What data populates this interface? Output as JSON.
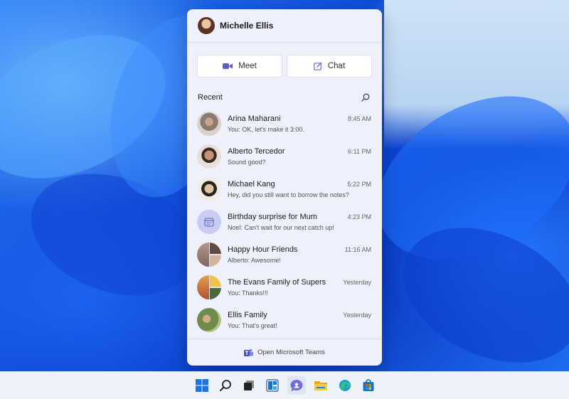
{
  "flyout": {
    "profile_name": "Michelle Ellis",
    "meet_label": "Meet",
    "chat_label": "Chat",
    "recent_title": "Recent",
    "conversations": [
      {
        "name": "Arina Maharani",
        "time": "8:45 AM",
        "preview": "You: OK, let's make it 3:00."
      },
      {
        "name": "Alberto Tercedor",
        "time": "6:11 PM",
        "preview": "Sound good?"
      },
      {
        "name": "Michael Kang",
        "time": "5:22 PM",
        "preview": "Hey, did you still want to borrow the notes?"
      },
      {
        "name": "Birthday surprise for Mum",
        "time": "4:23 PM",
        "preview": "Noel: Can't wait for our next catch up!"
      },
      {
        "name": "Happy Hour Friends",
        "time": "11:16 AM",
        "preview": "Alberto: Awesome!"
      },
      {
        "name": "The Evans Family of Supers",
        "time": "Yesterday",
        "preview": "You: Thanks!!!"
      },
      {
        "name": "Ellis Family",
        "time": "Yesterday",
        "preview": "You: That's great!"
      }
    ],
    "footer_label": "Open Microsoft Teams"
  },
  "taskbar": {
    "icons": [
      "start-icon",
      "search-icon",
      "task-view-icon",
      "widgets-icon",
      "teams-chat-icon",
      "file-explorer-icon",
      "edge-icon",
      "store-icon"
    ]
  },
  "colors": {
    "accent": "#5b5fc7",
    "flyout_bg": "#eef0fb",
    "wallpaper_blue": "#0a4fd8"
  }
}
